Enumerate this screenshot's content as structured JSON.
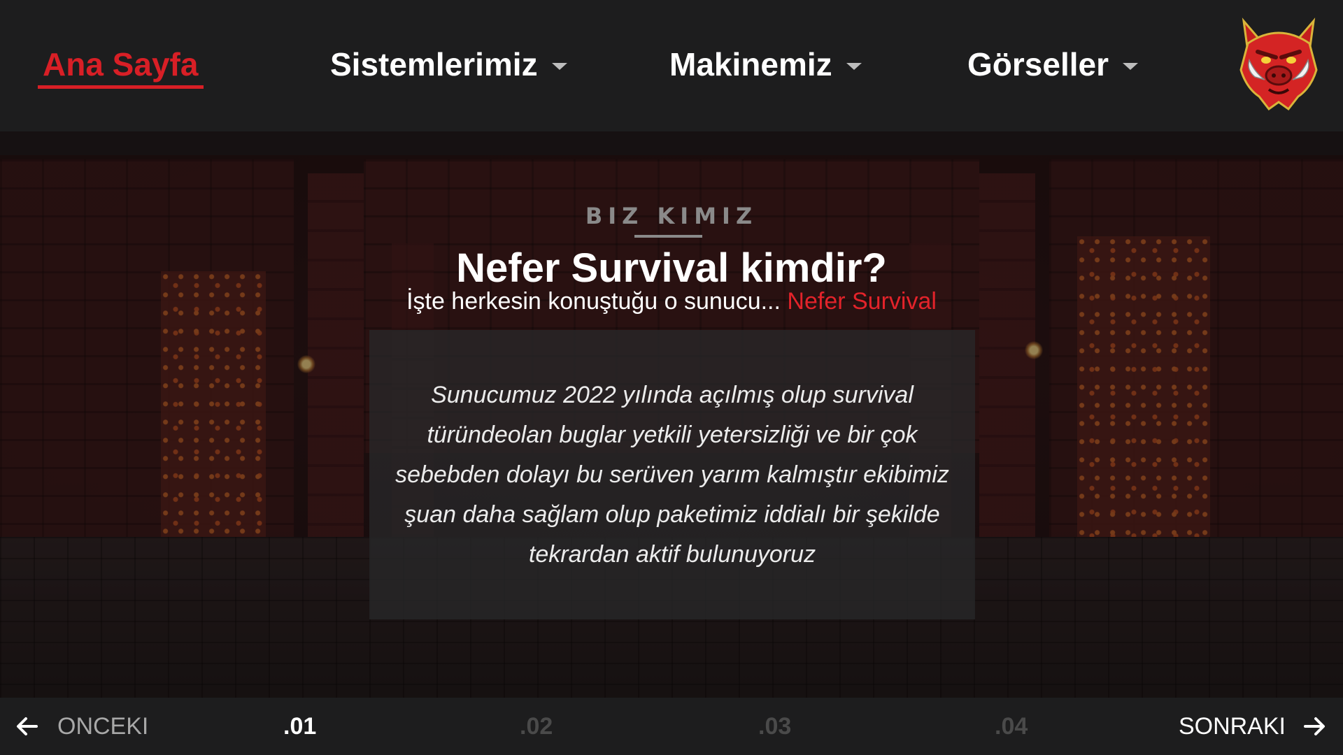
{
  "nav": {
    "items": [
      {
        "label": "Ana Sayfa",
        "active": true,
        "dropdown": false
      },
      {
        "label": "Sistemlerimiz",
        "active": false,
        "dropdown": true
      },
      {
        "label": "Makinemiz",
        "active": false,
        "dropdown": true
      },
      {
        "label": "Görseller",
        "active": false,
        "dropdown": true
      }
    ],
    "logo_icon": "red-boar-logo-icon"
  },
  "hero": {
    "section_tag": "BIZ KIMIZ",
    "title": "Nefer Survival kimdir?",
    "subtitle_prefix": "İşte herkesin konuştuğu o sunucu... ",
    "subtitle_brand": "Nefer Survival",
    "description": "Sunucumuz 2022 yılında açılmış olup survival türündeolan buglar yetkili yetersizliği ve bir çok sebebden dolayı bu serüven yarım kalmıştır ekibimiz şuan daha sağlam olup paketimiz iddialı bir şekilde tekrardan aktif bulunuyoruz"
  },
  "pager": {
    "prev_label": "ONCEKI",
    "next_label": "SONRAKI",
    "pages": [
      ".01",
      ".02",
      ".03",
      ".04"
    ],
    "current_page": ".01"
  },
  "colors": {
    "accent": "#d81f26",
    "background": "#1d1d1e",
    "card": "#282829"
  }
}
